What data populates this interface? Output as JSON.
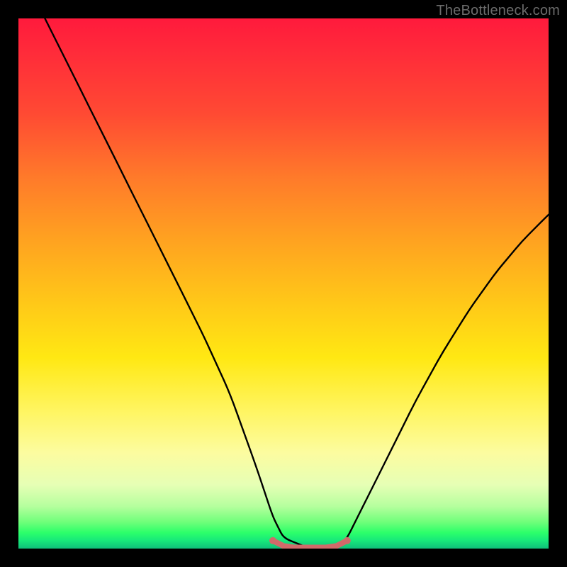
{
  "watermark": {
    "text": "TheBottleneck.com"
  },
  "chart_data": {
    "type": "line",
    "title": "",
    "xlabel": "",
    "ylabel": "",
    "xlim": [
      0,
      100
    ],
    "ylim": [
      0,
      100
    ],
    "grid": false,
    "legend": false,
    "background_gradient": {
      "orientation": "vertical",
      "stops": [
        {
          "pos": 0,
          "color": "#ff1a3c"
        },
        {
          "pos": 30,
          "color": "#ff7a2a"
        },
        {
          "pos": 55,
          "color": "#ffc918"
        },
        {
          "pos": 75,
          "color": "#fff561"
        },
        {
          "pos": 90,
          "color": "#b6ff9e"
        },
        {
          "pos": 100,
          "color": "#0fbf7a"
        }
      ]
    },
    "series": [
      {
        "name": "curve",
        "color": "#000000",
        "x": [
          5,
          10,
          15,
          20,
          25,
          30,
          35,
          40,
          45,
          48,
          50,
          55,
          60,
          62,
          65,
          70,
          75,
          80,
          85,
          90,
          95,
          100
        ],
        "y": [
          100,
          90,
          80,
          70,
          60,
          50,
          40,
          29,
          15,
          6,
          2,
          0,
          0,
          2,
          8,
          18,
          28,
          37,
          45,
          52,
          58,
          63
        ]
      },
      {
        "name": "flat-segment",
        "color": "#d06a6a",
        "thickness": 8,
        "x": [
          48,
          50,
          52,
          54,
          56,
          58,
          60,
          62
        ],
        "y": [
          1.5,
          0.5,
          0.2,
          0.2,
          0.2,
          0.2,
          0.5,
          1.5
        ]
      }
    ],
    "markers": [
      {
        "name": "flat-left-dot",
        "x": 48,
        "y": 1.5,
        "r": 5,
        "color": "#d06a6a"
      },
      {
        "name": "flat-right-dot",
        "x": 62,
        "y": 1.5,
        "r": 5,
        "color": "#d06a6a"
      }
    ]
  }
}
